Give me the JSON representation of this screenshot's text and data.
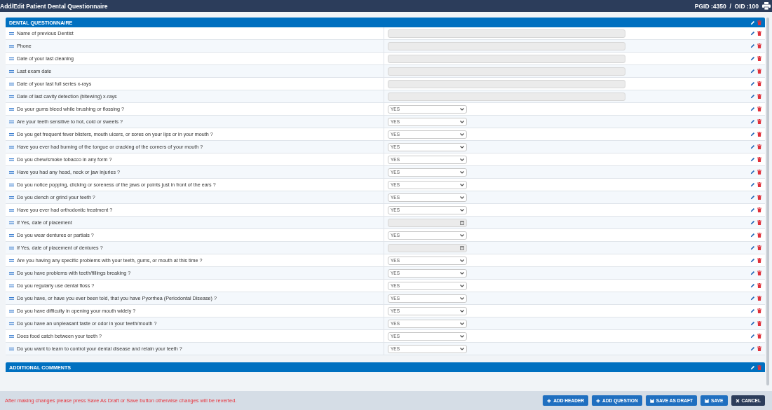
{
  "header": {
    "title": "Add/Edit Patient Dental Questionnaire",
    "ids": "PGID :4350  /  OID :100"
  },
  "sections": [
    {
      "title": "DENTAL QUESTIONNAIRE",
      "questions": [
        {
          "label": "Name of previous Dentist",
          "kind": "text"
        },
        {
          "label": "Phone",
          "kind": "text"
        },
        {
          "label": "Date of your last cleaning",
          "kind": "text"
        },
        {
          "label": "Last exam date",
          "kind": "text"
        },
        {
          "label": "Date of your last full series x-rays",
          "kind": "text"
        },
        {
          "label": "Date of last cavity detection (bitewing) x-rays",
          "kind": "text"
        },
        {
          "label": "Do your gums bleed while brushing or flossing ?",
          "kind": "select",
          "value": "YES"
        },
        {
          "label": "Are your teeth sensitive to hot, cold or sweets ?",
          "kind": "select",
          "value": "YES"
        },
        {
          "label": "Do you get frequent fever blisters, mouth ulcers, or sores on your lips or in your mouth ?",
          "kind": "select",
          "value": "YES"
        },
        {
          "label": "Have you ever had burning of the tongue or cracking of the corners of your mouth ?",
          "kind": "select",
          "value": "YES"
        },
        {
          "label": "Do you chew/smoke tobacco in any form ?",
          "kind": "select",
          "value": "YES"
        },
        {
          "label": "Have you had any head, neck or jaw injuries ?",
          "kind": "select",
          "value": "YES"
        },
        {
          "label": "Do you notice popping, clicking or soreness of the jaws or points just in front of the ears ?",
          "kind": "select",
          "value": "YES"
        },
        {
          "label": "Do you clench or grind your teeth ?",
          "kind": "select",
          "value": "YES"
        },
        {
          "label": "Have you ever had orthodontic treatment ?",
          "kind": "select",
          "value": "YES"
        },
        {
          "label": "If Yes, date of placement",
          "kind": "date"
        },
        {
          "label": "Do you wear dentures or partials ?",
          "kind": "select",
          "value": "YES"
        },
        {
          "label": "If Yes, date of placement of dentures ?",
          "kind": "date"
        },
        {
          "label": "Are you having any specific problems with your teeth, gums, or mouth at this time ?",
          "kind": "select",
          "value": "YES"
        },
        {
          "label": "Do you have problems with teeth/fillings breaking ?",
          "kind": "select",
          "value": "YES"
        },
        {
          "label": "Do you regularly use dental floss ?",
          "kind": "select",
          "value": "YES"
        },
        {
          "label": "Do you have, or have you ever been told, that you have Pyorrhea (Periodontal Disease) ?",
          "kind": "select",
          "value": "YES"
        },
        {
          "label": "Do you have difficulty in opening your mouth widely ?",
          "kind": "select",
          "value": "YES"
        },
        {
          "label": "Do you have an unpleasant taste or odor in your teeth/mouth ?",
          "kind": "select",
          "value": "YES"
        },
        {
          "label": "Does food catch between your teeth ?",
          "kind": "select",
          "value": "YES"
        },
        {
          "label": "Do you want to learn to control your dental disease and retain your teeth ?",
          "kind": "select",
          "value": "YES"
        }
      ]
    },
    {
      "title": "ADDITIONAL COMMENTS"
    }
  ],
  "footer": {
    "message": "After making changes please press Save As Draft or Save button otherwise changes will be reverted.",
    "buttons": [
      {
        "label": "ADD HEADER",
        "kind": "plus"
      },
      {
        "label": "ADD QUESTION",
        "kind": "plus"
      },
      {
        "label": "SAVE AS DRAFT",
        "kind": "save"
      },
      {
        "label": "SAVE",
        "kind": "save"
      },
      {
        "label": "CANCEL",
        "kind": "cancel"
      }
    ]
  }
}
